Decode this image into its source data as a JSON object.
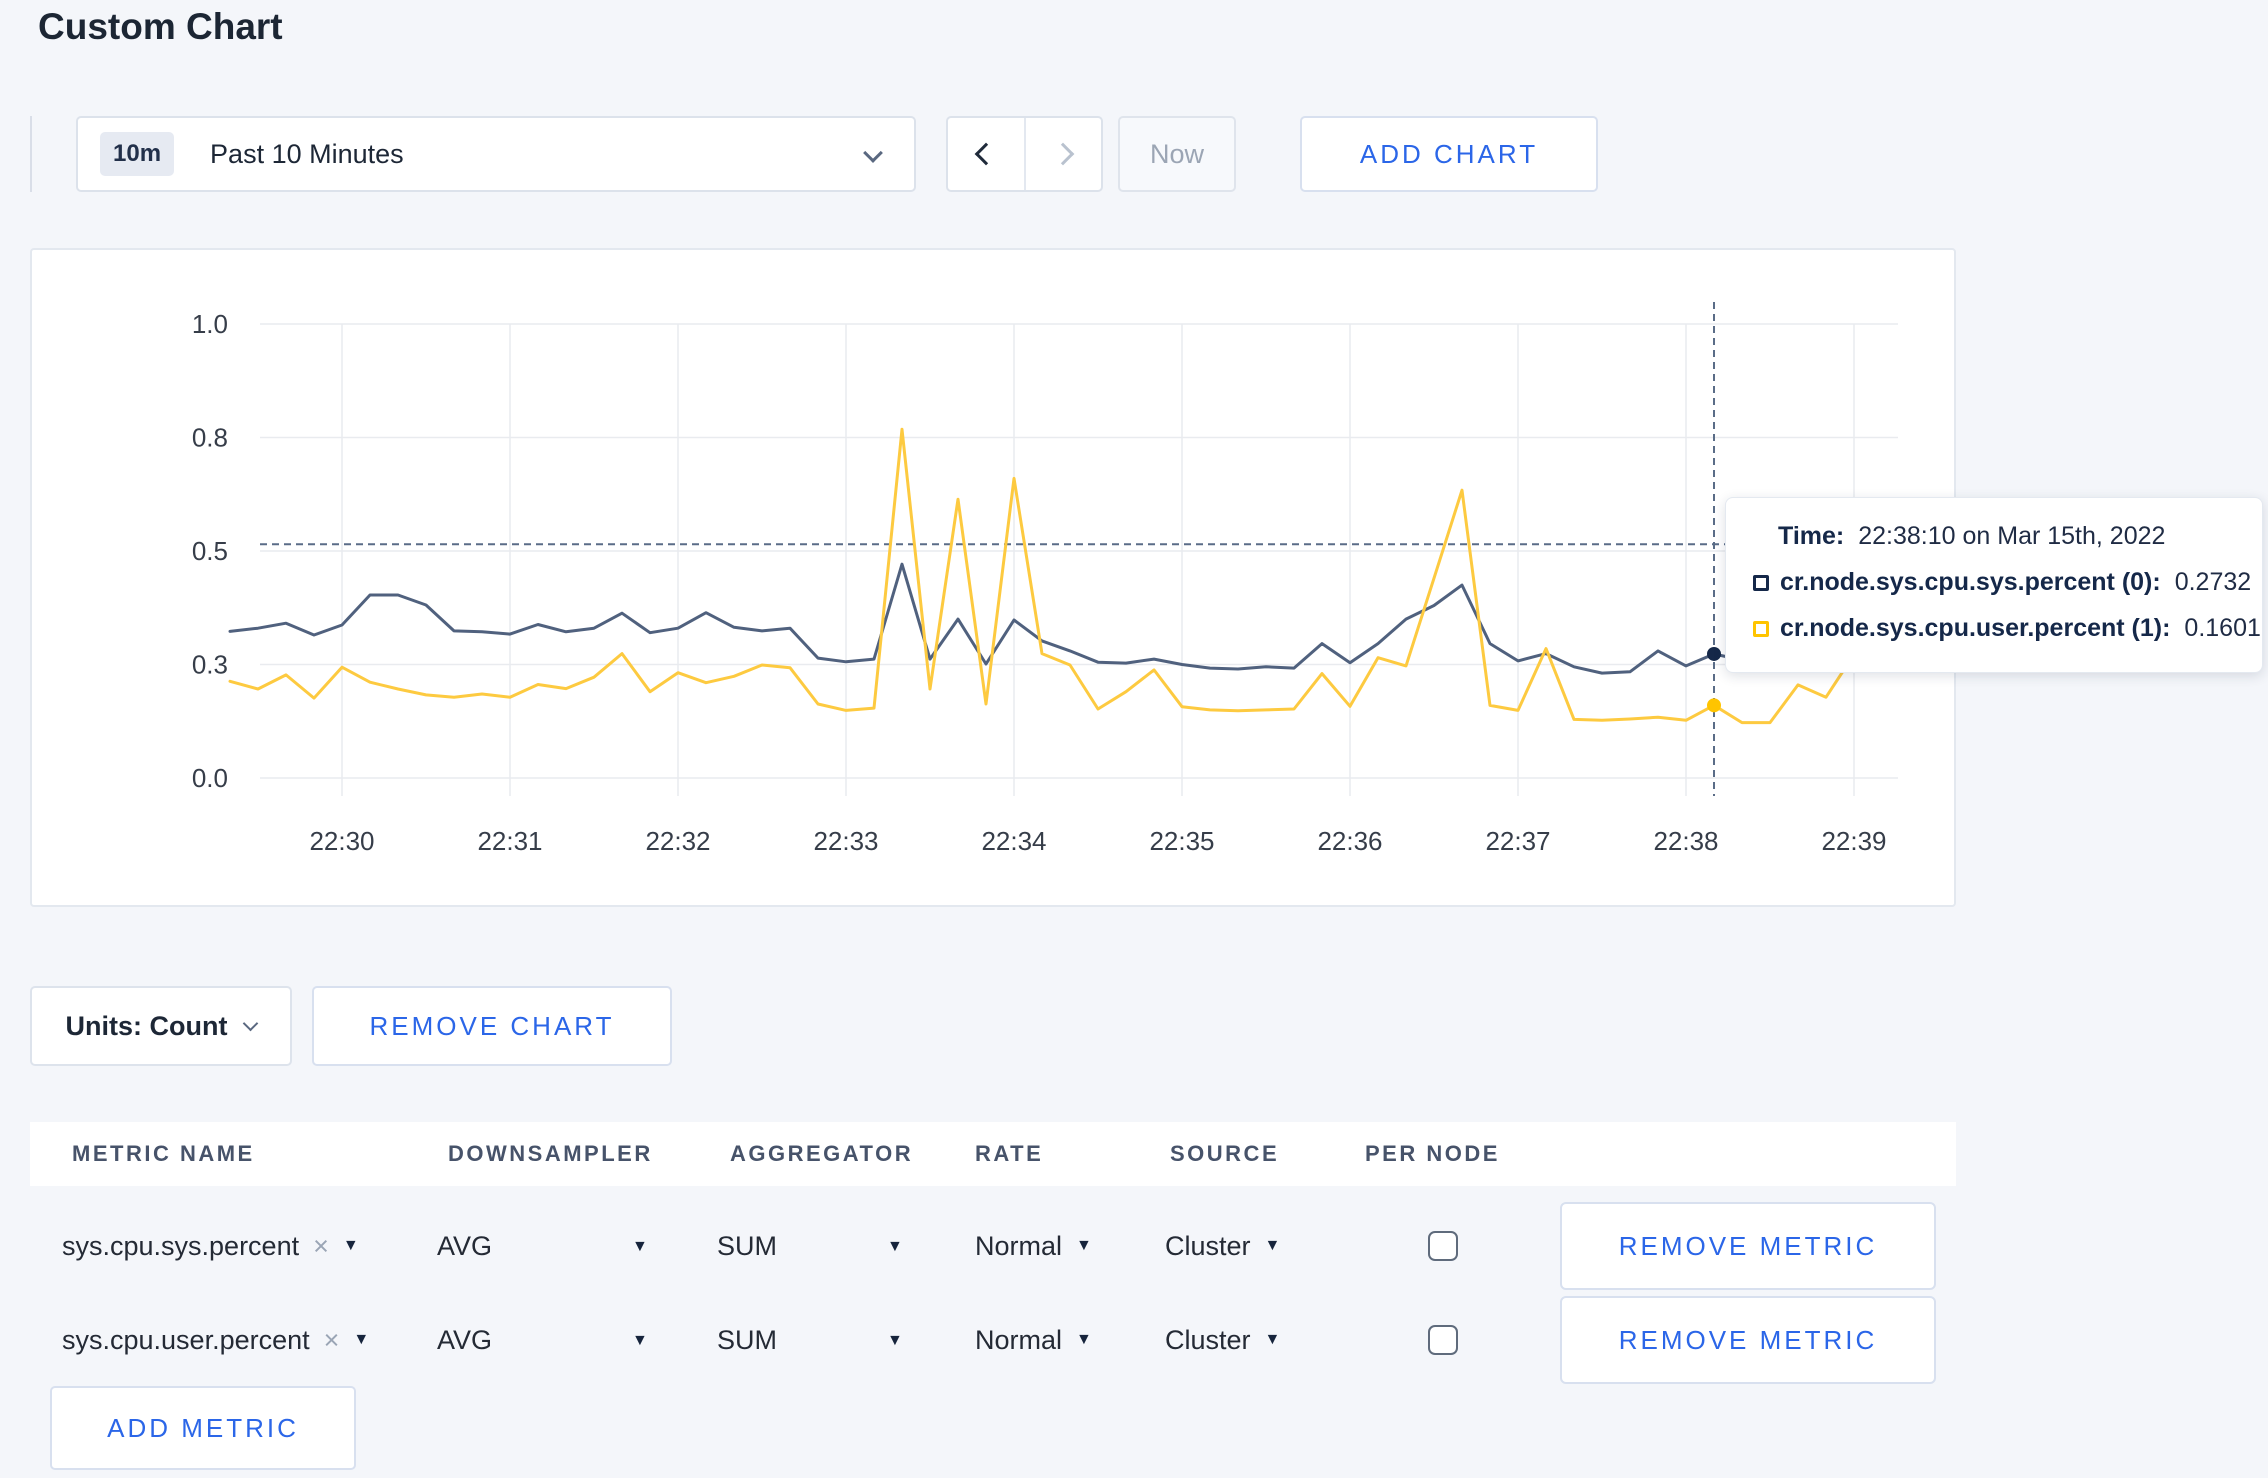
{
  "page": {
    "title": "Custom Chart"
  },
  "toolbar": {
    "time_range": {
      "badge": "10m",
      "label": "Past 10 Minutes"
    },
    "now_label": "Now",
    "add_chart_label": "ADD CHART"
  },
  "chart_data": {
    "type": "line",
    "title": "",
    "xlabel": "",
    "ylabel": "",
    "grid": true,
    "ylim": [
      0,
      1
    ],
    "y_tick_values": [
      0,
      0.25,
      0.5,
      0.75,
      1.0
    ],
    "y_tick_labels": [
      "0.0",
      "0.3",
      "0.5",
      "0.8",
      "1.0"
    ],
    "x_tick_labels": [
      "22:30",
      "22:31",
      "22:32",
      "22:33",
      "22:34",
      "22:35",
      "22:36",
      "22:37",
      "22:38",
      "22:39"
    ],
    "x_start_offset_min": -0.6667,
    "x_step_sec": 10,
    "series": [
      {
        "name": "cr.node.sys.cpu.sys.percent (0)",
        "color": "#50617e",
        "dot_color": "#152849",
        "values": [
          0.323,
          0.33,
          0.341,
          0.315,
          0.337,
          0.403,
          0.403,
          0.381,
          0.324,
          0.322,
          0.317,
          0.338,
          0.322,
          0.33,
          0.363,
          0.32,
          0.33,
          0.364,
          0.332,
          0.324,
          0.33,
          0.264,
          0.256,
          0.262,
          0.471,
          0.262,
          0.35,
          0.251,
          0.348,
          0.302,
          0.28,
          0.255,
          0.253,
          0.262,
          0.25,
          0.242,
          0.24,
          0.245,
          0.242,
          0.296,
          0.254,
          0.296,
          0.35,
          0.38,
          0.425,
          0.296,
          0.258,
          0.274,
          0.245,
          0.231,
          0.234,
          0.28,
          0.247,
          0.2732,
          0.26,
          0.315,
          0.29,
          0.275,
          0.27,
          0.3
        ]
      },
      {
        "name": "cr.node.sys.cpu.user.percent (1)",
        "color": "#fdca40",
        "dot_color": "#ffc400",
        "values": [
          0.213,
          0.196,
          0.227,
          0.176,
          0.244,
          0.211,
          0.196,
          0.183,
          0.178,
          0.185,
          0.178,
          0.206,
          0.197,
          0.222,
          0.274,
          0.19,
          0.232,
          0.21,
          0.224,
          0.249,
          0.243,
          0.163,
          0.149,
          0.154,
          0.768,
          0.196,
          0.614,
          0.163,
          0.66,
          0.274,
          0.249,
          0.152,
          0.19,
          0.238,
          0.157,
          0.15,
          0.148,
          0.15,
          0.152,
          0.23,
          0.158,
          0.265,
          0.247,
          0.44,
          0.634,
          0.16,
          0.149,
          0.285,
          0.129,
          0.127,
          0.13,
          0.134,
          0.127,
          0.1601,
          0.122,
          0.122,
          0.205,
          0.178,
          0.272,
          0.238
        ]
      }
    ],
    "hover": {
      "index": 53,
      "time_min": 8.1667,
      "guide_value": 0.515
    },
    "legend_position": "tooltip"
  },
  "tooltip": {
    "time_label": "Time:",
    "time_value": "22:38:10 on Mar 15th, 2022",
    "rows": [
      {
        "label": "cr.node.sys.cpu.sys.percent (0):",
        "value": "0.2732",
        "color": "#152849"
      },
      {
        "label": "cr.node.sys.cpu.user.percent (1):",
        "value": "0.1601",
        "color": "#ffc400"
      }
    ]
  },
  "chart_controls": {
    "units_label": "Units: Count",
    "remove_chart_label": "REMOVE CHART"
  },
  "metrics_table": {
    "headers": [
      "METRIC NAME",
      "DOWNSAMPLER",
      "AGGREGATOR",
      "RATE",
      "SOURCE",
      "PER NODE"
    ],
    "rows": [
      {
        "metric": "sys.cpu.sys.percent",
        "clear": "×",
        "downsampler": "AVG",
        "aggregator": "SUM",
        "rate": "Normal",
        "source": "Cluster",
        "per_node_checked": false,
        "remove_label": "REMOVE METRIC"
      },
      {
        "metric": "sys.cpu.user.percent",
        "clear": "×",
        "downsampler": "AVG",
        "aggregator": "SUM",
        "rate": "Normal",
        "source": "Cluster",
        "per_node_checked": false,
        "remove_label": "REMOVE METRIC"
      }
    ],
    "add_metric_label": "ADD METRIC"
  },
  "colors": {
    "accent_blue": "#2b66e8",
    "page_bg": "#f4f6fa",
    "series_sys": "#50617e",
    "series_user": "#fdca40",
    "grid": "#e9ebef"
  }
}
